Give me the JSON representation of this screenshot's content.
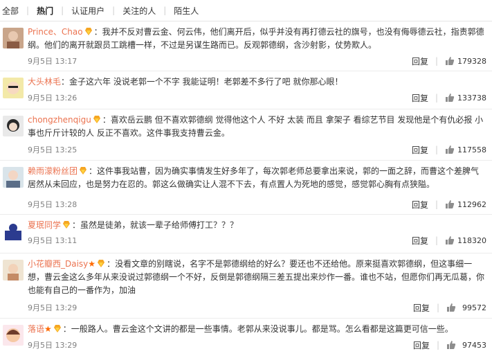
{
  "tabs": [
    {
      "label": "全部",
      "active": false
    },
    {
      "label": "热门",
      "active": true
    },
    {
      "label": "认证用户",
      "active": false
    },
    {
      "label": "关注的人",
      "active": false
    },
    {
      "label": "陌生人",
      "active": false
    }
  ],
  "reply_label": "回复",
  "colors": {
    "username": "#eb7350",
    "meta": "#808080",
    "vip_badge": "#f5a623"
  },
  "comments": [
    {
      "username": "Prince、Chao",
      "text": "：我并不反对曹云金、何云伟，他们离开后，似乎并没有再打德云社的旗号，也没有侮辱德云社，指责郭德纲。他们的离开就跟员工跳槽一样，不过是另谋生路而已。反观郭德纲，含沙射影，仗势欺人。",
      "time": "9月5日 13:17",
      "likes": "179328",
      "avatar_icon": "avatar-icon"
    },
    {
      "username": "大头林毛",
      "text": "：金子这六年 没说老郭一个不字 我能证明！老郭差不多行了吧 就你那心眼！",
      "time": "9月5日 13:26",
      "likes": "133738",
      "avatar_icon": "avatar-icon"
    },
    {
      "username": "chongzhenqigu",
      "text": "：喜欢岳云鹏 但不喜欢郭德纲 觉得他这个人 不好 太装 而且 拿架子 看综艺节目 发现他是个有仇必报 小事也斤斤计较的人 反正不喜欢。这件事我支持曹云金。",
      "time": "9月5日 13:25",
      "likes": "117558",
      "avatar_icon": "avatar-icon"
    },
    {
      "username": "赖雨濛粉丝团",
      "text": "：这件事我站曹，因为确实事情发生好多年了，每次郭老师总要拿出来说，郭的一面之辞，而曹这个差脾气居然从未回应，也是努力在忍的。郭这么做确实让人混不下去，有点置人为死地的感觉，感觉郭心胸有点狭隘。",
      "time": "9月5日 13:28",
      "likes": "112962",
      "avatar_icon": "avatar-icon"
    },
    {
      "username": "夏珉同学",
      "text": "：虽然是徒弟，就该一辈子给师傅打工？？？",
      "time": "9月5日 13:11",
      "likes": "118320",
      "avatar_icon": "avatar-icon"
    },
    {
      "username": "小花瓣西_Daisy",
      "text": "：没看文章的别瞎说，名字不是郭德纲给的好么？要还也不还给他。原来挺喜欢郭德纲，但这事细一想，曹云金这么多年从来没说过郭德纲一个不好，反倒是郭德纲隔三差五提出来炒作一番。谁也不站，但愿你们再无瓜葛，你也能有自己的一番作为，加油",
      "time": "9月5日 13:29",
      "likes": "99572",
      "avatar_icon": "avatar-icon"
    },
    {
      "username": "落语",
      "text": "：一般路人。曹云金这个文讲的都是一些事情。老郭从来没说事儿。都是骂。怎么看都是这篇更可信一些。",
      "time": "9月5日 13:29",
      "likes": "97453",
      "avatar_icon": "avatar-icon"
    }
  ]
}
